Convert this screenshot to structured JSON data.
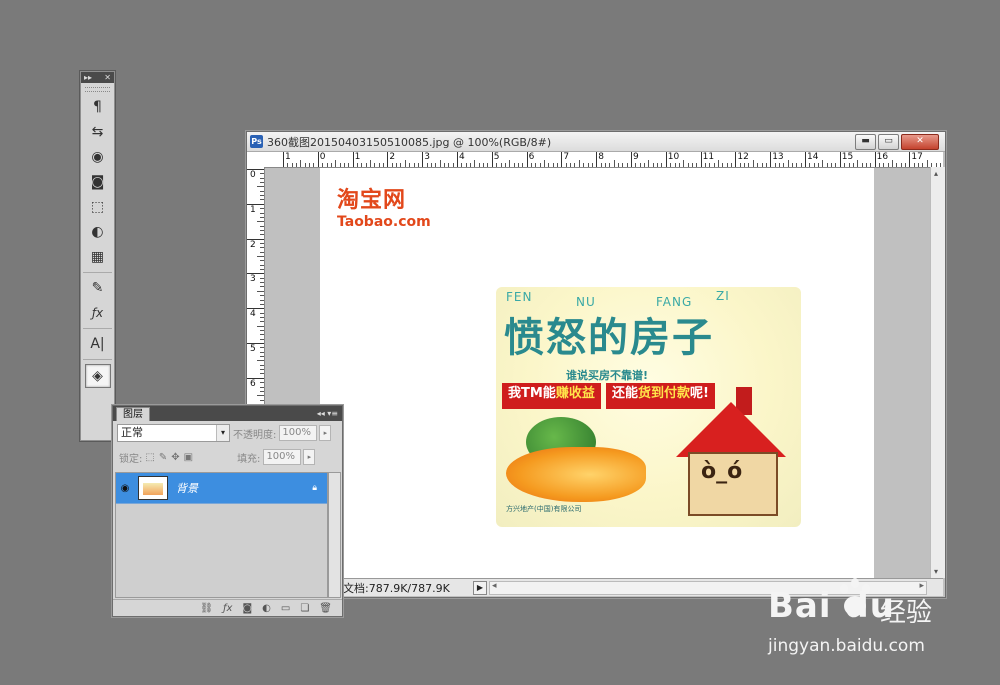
{
  "colors": {
    "background": "#7a7a7a",
    "layer_selected": "#3d8ee0",
    "taobao_orange": "#e2481b",
    "poster_teal": "#2a8a8e",
    "poster_red": "#cf1d1d"
  },
  "toolstrip": {
    "topbar_left": "▸▸",
    "topbar_right": "✕",
    "tools": [
      {
        "name": "paragraph-icon",
        "glyph": "¶"
      },
      {
        "name": "clone-source-icon",
        "glyph": "⇆"
      },
      {
        "name": "3d-icon",
        "glyph": "◉"
      },
      {
        "name": "mask-icon",
        "glyph": "◙"
      },
      {
        "name": "transform-icon",
        "glyph": "⬚"
      },
      {
        "name": "adjustments-icon",
        "glyph": "◐"
      },
      {
        "name": "grid-icon",
        "glyph": "▦"
      },
      {
        "name": "styles-icon",
        "glyph": "✎"
      },
      {
        "name": "fx-icon",
        "glyph": "ƒx"
      },
      {
        "name": "character-icon",
        "glyph": "A|"
      },
      {
        "name": "layers-icon",
        "glyph": "◈"
      }
    ]
  },
  "document": {
    "ps_badge": "Ps",
    "title": "360截图20150403150510085.jpg @ 100%(RGB/8#)",
    "btn_minimize": "▬",
    "btn_restore": "▭",
    "btn_close": "✕",
    "ruler_h": [
      "1",
      "0",
      "1",
      "2",
      "3",
      "4",
      "5",
      "6",
      "7",
      "8",
      "9",
      "10",
      "11",
      "12",
      "13",
      "14",
      "15",
      "16",
      "17"
    ],
    "ruler_v": [
      "0",
      "1",
      "2",
      "3",
      "4",
      "5",
      "6"
    ],
    "status": "文档:787.9K/787.9K",
    "status_arrow": "▶",
    "scroll_left": "◂",
    "scroll_right": "▸",
    "scroll_up": "▴",
    "scroll_down": "▾"
  },
  "canvas_content": {
    "taobao_cn": "淘宝网",
    "taobao_en": "Taobao.com",
    "pinyin": [
      "FEN",
      "NU",
      "FANG",
      "ZI"
    ],
    "poster_title": "愤怒的房子",
    "poster_subtitle": "谁说买房不靠谱!",
    "banner1_prefix": "我TM能",
    "banner1_highlight": "赚收益",
    "banner2_prefix": "还能",
    "banner2_highlight": "货到付款",
    "banner2_suffix": "呢!",
    "footer": "方兴地产(中国)有限公司"
  },
  "layers_panel": {
    "tab": "图层",
    "header_icons": "◂◂ ▾≡",
    "blend_mode": "正常",
    "opacity_label": "不透明度:",
    "opacity_value": "100%",
    "lock_label": "锁定:",
    "fill_label": "填充:",
    "fill_value": "100%",
    "layers": [
      {
        "name": "背景",
        "visible": true,
        "locked": true,
        "selected": true
      }
    ],
    "footer_icons": [
      "link-icon",
      "fx-icon",
      "mask-icon",
      "adjustment-icon",
      "folder-icon",
      "new-layer-icon",
      "trash-icon"
    ]
  },
  "watermark": {
    "brand": "Bai du",
    "product": "经验",
    "url": "jingyan.baidu.com"
  }
}
